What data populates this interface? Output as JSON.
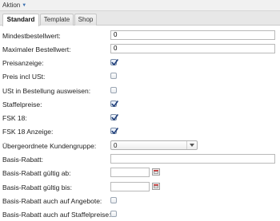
{
  "menu": {
    "label": "Aktion",
    "caret_icon": "caret-down-icon"
  },
  "tabs": [
    {
      "label": "Standard",
      "active": true
    },
    {
      "label": "Template",
      "active": false
    },
    {
      "label": "Shop",
      "active": false
    }
  ],
  "fields": {
    "mindestbestellwert": {
      "label": "Mindestbestellwert:",
      "value": "0"
    },
    "maximaler_bestellwert": {
      "label": "Maximaler Bestellwert:",
      "value": "0"
    },
    "preisanzeige": {
      "label": "Preisanzeige:",
      "checked": true
    },
    "preis_incl_ust": {
      "label": "Preis incl USt:",
      "checked": false
    },
    "ust_bestellung": {
      "label": "USt in Bestellung ausweisen:",
      "checked": false
    },
    "staffelpreise": {
      "label": "Staffelpreise:",
      "checked": true
    },
    "fsk18": {
      "label": "FSK 18:",
      "checked": true
    },
    "fsk18_anzeige": {
      "label": "FSK 18 Anzeige:",
      "checked": true
    },
    "kundengruppe": {
      "label": "Übergeordnete Kundengruppe:",
      "value": "0"
    },
    "basis_rabatt": {
      "label": "Basis-Rabatt:",
      "value": ""
    },
    "rabatt_ab": {
      "label": "Basis-Rabatt gültig ab:",
      "value": ""
    },
    "rabatt_bis": {
      "label": "Basis-Rabatt gültig bis:",
      "value": ""
    },
    "rabatt_angebote": {
      "label": "Basis-Rabatt auch auf Angebote:",
      "checked": false
    },
    "rabatt_staffelpreise": {
      "label": "Basis-Rabatt auch auf Staffelpreise:",
      "checked": false
    }
  }
}
